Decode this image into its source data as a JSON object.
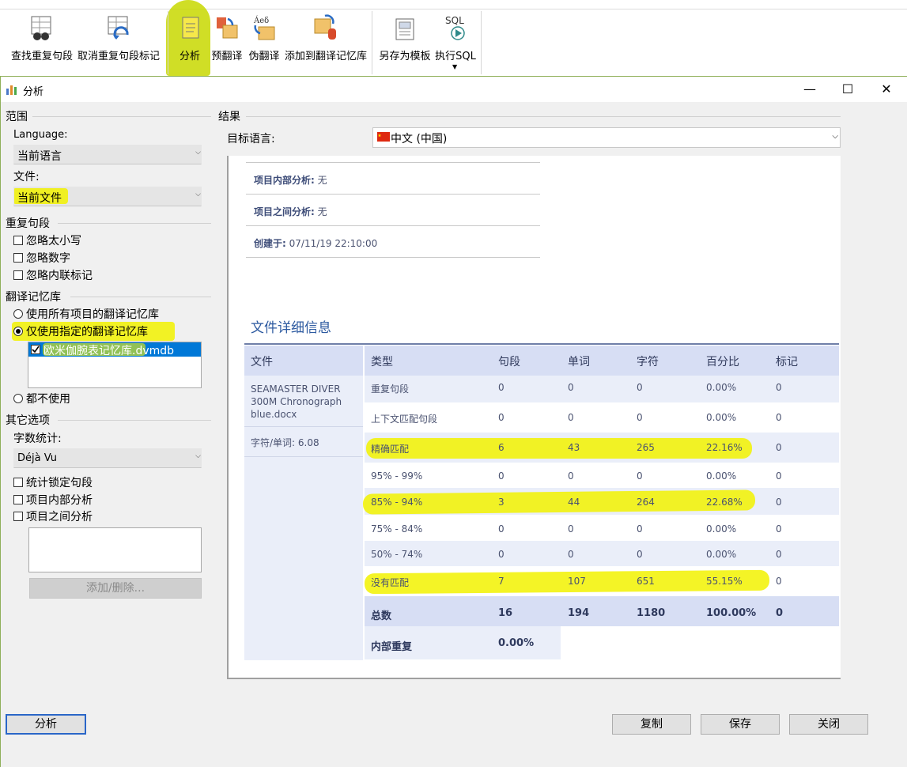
{
  "ribbon": {
    "buttons": [
      {
        "label": "查找重复句段",
        "icon": "find-duplicates-icon"
      },
      {
        "label": "取消重复句段标记",
        "icon": "unmark-duplicates-icon"
      },
      {
        "label": "分析",
        "icon": "analyze-icon"
      },
      {
        "label": "预翻译",
        "icon": "pretranslate-icon"
      },
      {
        "label": "伪翻译",
        "icon": "pseudo-translate-icon"
      },
      {
        "label": "添加到翻译记忆库",
        "icon": "add-to-memory-icon"
      },
      {
        "label": "另存为模板",
        "icon": "save-template-icon"
      },
      {
        "label": "执行SQL",
        "icon": "sql-icon",
        "icon_text": "SQL"
      }
    ]
  },
  "window": {
    "title": "分析",
    "controls": [
      "—",
      "☐",
      "✕"
    ]
  },
  "left": {
    "scope_title": "范围",
    "language_label": "Language:",
    "language_value": "当前语言",
    "file_label": "文件:",
    "file_value": "当前文件",
    "dup_title": "重复句段",
    "dup_options": [
      "忽略太小写",
      "忽略数字",
      "忽略内联标记"
    ],
    "memory_title": "翻译记忆库",
    "memory_options": [
      "使用所有项目的翻译记忆库",
      "仅使用指定的翻译记忆库",
      "都不使用"
    ],
    "memory_selected": 1,
    "memory_list": [
      "欧米伽腕表记忆库.dvmdb"
    ],
    "other_title": "其它选项",
    "count_label": "字数统计:",
    "count_value": "Déjà Vu",
    "other_options": [
      "统计锁定句段",
      "项目内部分析",
      "项目之间分析"
    ],
    "add_remove_label": "添加/删除..."
  },
  "results": {
    "title": "结果",
    "target_label": "目标语言:",
    "target_value": "中文 (中国)",
    "meta": [
      {
        "key": "项目内部分析:",
        "value": "无"
      },
      {
        "key": "项目之间分析:",
        "value": "无"
      },
      {
        "key": "创建于:",
        "value": "07/11/19 22:10:00"
      }
    ],
    "details_title": "文件详细信息",
    "file_header": "文件",
    "file_name_lines": [
      "SEAMASTER DIVER",
      "300M Chronograph",
      "blue.docx"
    ],
    "chars_per_word": "字符/单词: 6.08",
    "columns": [
      "类型",
      "句段",
      "单词",
      "字符",
      "百分比",
      "标记"
    ],
    "rows": [
      [
        "重复句段",
        "0",
        "0",
        "0",
        "0.00%",
        "0"
      ],
      [
        "上下文匹配句段",
        "0",
        "0",
        "0",
        "0.00%",
        "0"
      ],
      [
        "精确匹配",
        "6",
        "43",
        "265",
        "22.16%",
        "0"
      ],
      [
        "95% - 99%",
        "0",
        "0",
        "0",
        "0.00%",
        "0"
      ],
      [
        "85% - 94%",
        "3",
        "44",
        "264",
        "22.68%",
        "0"
      ],
      [
        "75% - 84%",
        "0",
        "0",
        "0",
        "0.00%",
        "0"
      ],
      [
        "50% - 74%",
        "0",
        "0",
        "0",
        "0.00%",
        "0"
      ],
      [
        "没有匹配",
        "7",
        "107",
        "651",
        "55.15%",
        "0"
      ]
    ],
    "total": [
      "总数",
      "16",
      "194",
      "1180",
      "100.00%",
      "0"
    ],
    "internal_dup": [
      "内部重复",
      "0.00%"
    ]
  },
  "footer": {
    "analyze": "分析",
    "copy": "复制",
    "save": "保存",
    "close": "关闭"
  },
  "colors": {
    "highlight": "#f2f200",
    "header_bg": "#d7def4",
    "accent": "#2d5aa0"
  }
}
